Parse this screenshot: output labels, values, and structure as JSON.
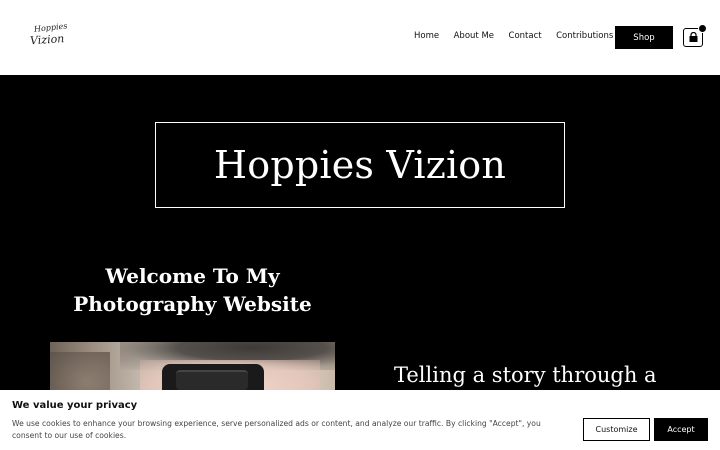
{
  "header": {
    "logo_line1": "Hoppies",
    "logo_line2": "Vizion",
    "nav": [
      "Home",
      "About Me",
      "Contact",
      "Contributions"
    ],
    "shop_label": "Shop"
  },
  "hero": {
    "title": "Hoppies Vizion",
    "welcome": "Welcome To My Photography Website",
    "tagline": "Telling a story through a"
  },
  "cookie": {
    "title": "We value your privacy",
    "text": "We use cookies to enhance your browsing experience, serve personalized ads or content, and analyze our traffic. By clicking \"Accept\", you consent to our use of cookies.",
    "customize_label": "Customize",
    "accept_label": "Accept"
  },
  "icons": {
    "cart": "shopping-bag-icon"
  },
  "colors": {
    "background": "#000000",
    "header": "#ffffff",
    "accent": "#000000"
  }
}
